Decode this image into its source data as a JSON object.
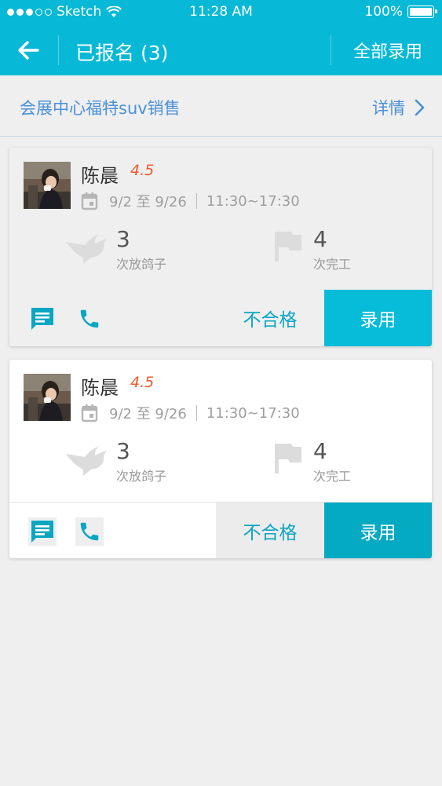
{
  "status_bar": {
    "carrier": "Sketch",
    "time": "11:28 AM",
    "battery": "100%"
  },
  "nav": {
    "title": "已报名 (3)",
    "action": "全部录用"
  },
  "job": {
    "title": "会展中心福特suv销售",
    "detail": "详情"
  },
  "applicants": [
    {
      "name": "陈晨",
      "rating": "4.5",
      "date_range": "9/2 至 9/26",
      "time_range": "11:30~17:30",
      "pigeon_count": "3",
      "pigeon_label": "次放鸽子",
      "done_count": "4",
      "done_label": "次完工",
      "reject_label": "不合格",
      "hire_label": "录用"
    },
    {
      "name": "陈晨",
      "rating": "4.5",
      "date_range": "9/2 至 9/26",
      "time_range": "11:30~17:30",
      "pigeon_count": "3",
      "pigeon_label": "次放鸽子",
      "done_count": "4",
      "done_label": "次完工",
      "reject_label": "不合格",
      "hire_label": "录用"
    }
  ],
  "icons": {
    "back": "arrow-left-icon",
    "detail": "chevron-right-icon",
    "calendar": "calendar-icon",
    "pigeon": "pigeon-icon",
    "done": "flag-icon",
    "message": "message-icon",
    "phone": "phone-icon"
  },
  "colors": {
    "primary": "#07b9d6",
    "link": "#4a90d9",
    "rating": "#ef5a28",
    "muted_icon": "#dcdcdc"
  }
}
